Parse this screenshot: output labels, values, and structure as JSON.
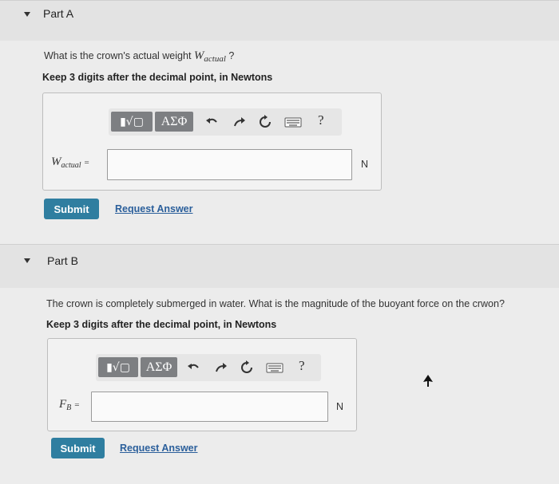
{
  "partA": {
    "title": "Part A",
    "question_text": "What is the crown's actual weight ",
    "question_var": "W",
    "question_var_sub": "actual",
    "question_mark": " ?",
    "instruction": "Keep 3 digits after the decimal point, in Newtons",
    "toolbar": {
      "templates_glyph": "▮√▢",
      "greek": "ΑΣΦ",
      "help": "?"
    },
    "answer_label": "W",
    "answer_label_sub": "actual",
    "equals": "=",
    "answer_value": "",
    "unit": "N",
    "submit": "Submit",
    "request": "Request Answer"
  },
  "partB": {
    "title": "Part B",
    "question_text": "The crown is completely submerged in water. What is the magnitude of the buoyant force on the crwon?",
    "instruction": "Keep 3 digits after the decimal point, in Newtons",
    "toolbar": {
      "templates_glyph": "▮√▢",
      "greek": "ΑΣΦ",
      "help": "?"
    },
    "answer_label": "F",
    "answer_label_sub": "B",
    "equals": "=",
    "answer_value": "",
    "unit": "N",
    "submit": "Submit",
    "request": "Request Answer"
  },
  "icons": [
    "collapse-arrow-icon",
    "templates-icon",
    "greek-symbols-icon",
    "undo-icon",
    "redo-icon",
    "reset-icon",
    "keyboard-icon",
    "help-icon",
    "mouse-cursor-icon"
  ]
}
